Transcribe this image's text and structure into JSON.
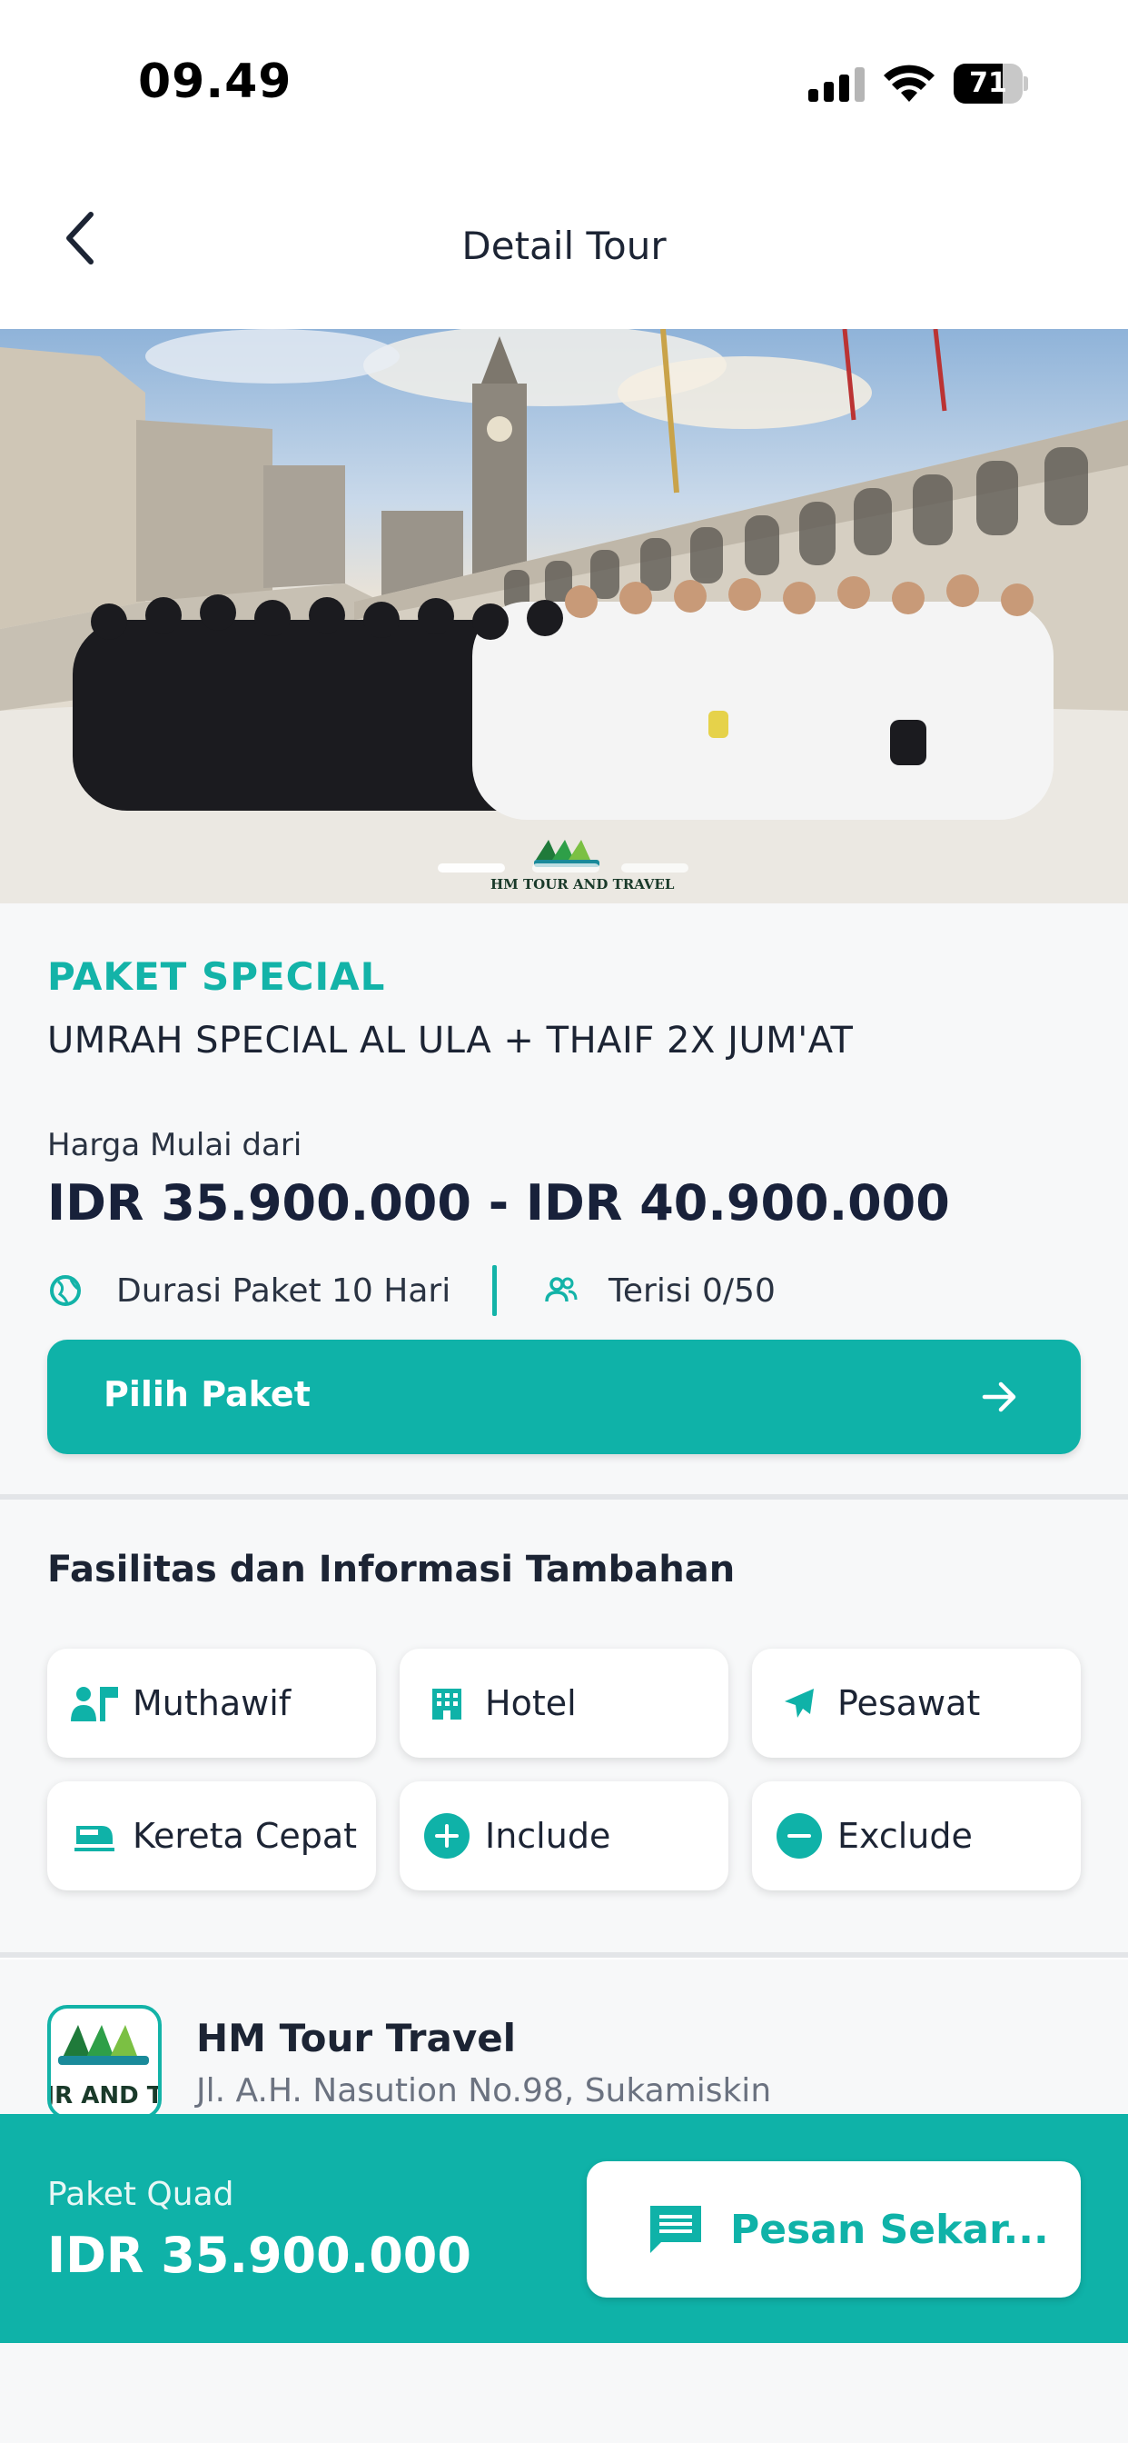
{
  "status_bar": {
    "time": "09.49",
    "battery": "71",
    "battery_level": 0.71
  },
  "header": {
    "title": "Detail Tour"
  },
  "hero": {
    "logo_text": "HM TOUR AND TRAVEL",
    "pager_count": 3,
    "pager_active": 0
  },
  "package": {
    "category": "PAKET SPECIAL",
    "name": "UMRAH SPECIAL AL ULA + THAIF 2X JUM'AT",
    "price_label": "Harga Mulai dari",
    "price_range": "IDR 35.900.000 - IDR 40.900.000",
    "duration": "Durasi Paket 10 Hari",
    "capacity": "Terisi 0/50",
    "choose_label": "Pilih Paket"
  },
  "facilities": {
    "title": "Fasilitas dan Informasi Tambahan",
    "items": [
      {
        "label": "Muthawif",
        "icon": "guide-icon"
      },
      {
        "label": "Hotel",
        "icon": "hotel-icon"
      },
      {
        "label": "Pesawat",
        "icon": "airplane-icon"
      },
      {
        "label": "Kereta Cepat",
        "icon": "train-icon"
      },
      {
        "label": "Include",
        "icon": "plus-circle-icon"
      },
      {
        "label": "Exclude",
        "icon": "minus-circle-icon"
      }
    ]
  },
  "agent": {
    "name": "HM Tour Travel",
    "address": "Jl. A.H. Nasution No.98, Sukamiskin",
    "logo_text": "JR AND T"
  },
  "bottom_bar": {
    "package_type": "Paket Quad",
    "price": "IDR 35.900.000",
    "order_label": "Pesan Sekar..."
  },
  "colors": {
    "accent": "#0fb2a8",
    "text": "#1c2434"
  }
}
